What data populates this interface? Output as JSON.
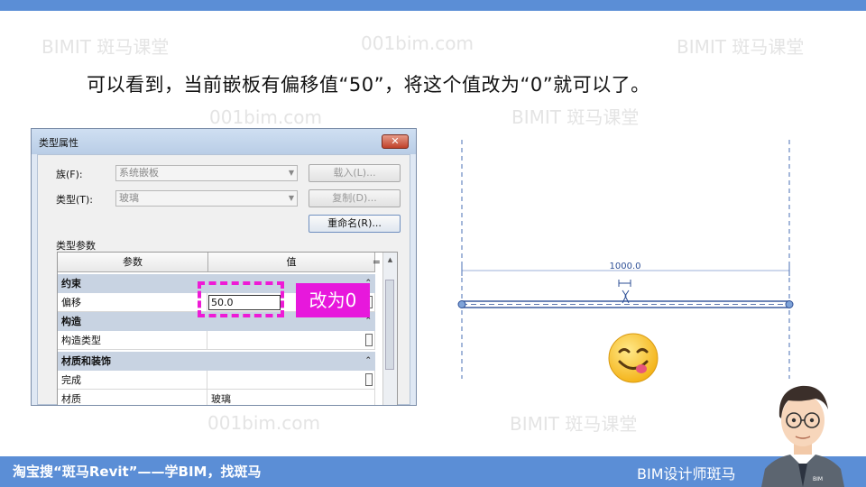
{
  "watermarks": [
    {
      "id": "wm1",
      "text": "BIMIT 斑马课堂"
    },
    {
      "id": "wm2",
      "text": "001bim.com"
    },
    {
      "id": "wm3",
      "text": "BIMIT 斑马课堂"
    },
    {
      "id": "wm4",
      "text": "001bim.com"
    },
    {
      "id": "wm5",
      "text": "BIMIT 斑马课堂"
    },
    {
      "id": "wm6",
      "text": "001bim.com"
    },
    {
      "id": "wm7",
      "text": "BIMIT 斑马课堂"
    }
  ],
  "caption": "可以看到，当前嵌板有偏移值“50”，将这个值改为“0”就可以了。",
  "dialog": {
    "title": "类型属性",
    "close_icon": "close-icon",
    "family_label": "族(F):",
    "family_value": "系统嵌板",
    "type_label": "类型(T):",
    "type_value": "玻璃",
    "load_button": "载入(L)...",
    "duplicate_button": "复制(D)...",
    "rename_button": "重命名(R)...",
    "section_label": "类型参数",
    "columns": [
      "参数",
      "值"
    ],
    "eq_symbol": "=",
    "rows": [
      {
        "group": "约束",
        "param": "偏移",
        "value": "50.0"
      },
      {
        "group": "构造",
        "param": "构造类型",
        "value": ""
      },
      {
        "group": "材质和装饰",
        "param": "完成",
        "value": ""
      },
      {
        "group": "",
        "param": "材质",
        "value": "玻璃"
      }
    ]
  },
  "annotation": {
    "tag": "改为0",
    "color": "#e718dc"
  },
  "drawing": {
    "dimension": "1000.0"
  },
  "footer": {
    "left": "淘宝搜“斑马Revit”——学BIM，找斑马",
    "right": "BIM设计师斑马",
    "avatar_badge": "BIM"
  },
  "colors": {
    "accent": "#5b8ed6",
    "magenta": "#ee1ad6",
    "drawing_line": "#4a6fb5"
  }
}
